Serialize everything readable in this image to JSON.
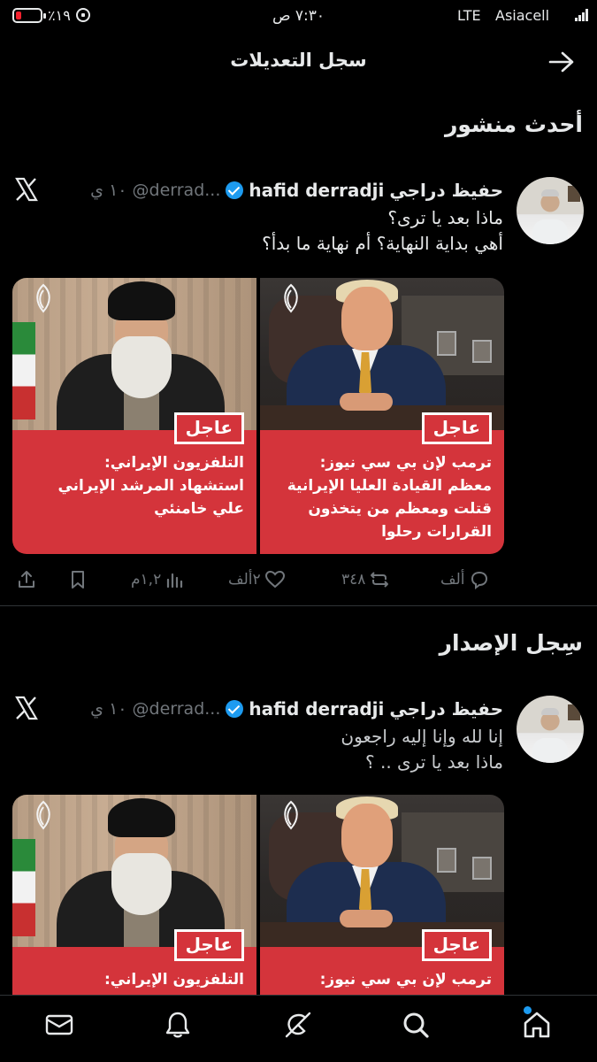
{
  "status_bar": {
    "time": "٧:٣٠ ص",
    "battery": "٪١٩",
    "network": "LTE",
    "carrier": "Asiacell"
  },
  "header": {
    "title": "سجل التعديلات",
    "back_icon": "arrow-right-icon"
  },
  "sections": {
    "latest": "أحدث منشور",
    "history": "سِجل الإصدار"
  },
  "tweets": [
    {
      "name": "حفيظ دراجي",
      "name_latin": "hafid derradji",
      "handle": "@derrad...",
      "time": "١٠ ي",
      "lines": [
        "ماذا بعد يا ترى؟",
        "أهي بداية النهاية؟ أم نهاية ما بدأ؟"
      ],
      "cards": [
        {
          "badge": "عاجل",
          "lines": [
            "ترمب لإن بي سي نيوز:",
            "معظم القيادة العليا الإيرانية",
            "قتلت ومعظم من يتخذون",
            "القرارات رحلوا"
          ]
        },
        {
          "badge": "عاجل",
          "lines": [
            "التلفزيون الإيراني:",
            "استشهاد المرشد الإيراني",
            "علي خامنئي"
          ]
        }
      ],
      "actions": {
        "replies": "ألف",
        "reposts": "٣٤٨",
        "likes": "٢ألف",
        "views": "١,٢م"
      }
    },
    {
      "name": "حفيظ دراجي",
      "name_latin": "hafid derradji",
      "handle": "@derrad...",
      "time": "١٠ ي",
      "lines": [
        "إنا لله وإنا إليه راجعون",
        "ماذا بعد يا ترى .. ؟"
      ],
      "cards": [
        {
          "badge": "عاجل",
          "lines": [
            "ترمب لإن بي سي نيوز:"
          ]
        },
        {
          "badge": "عاجل",
          "lines": [
            "التلفزيون الإيراني:"
          ]
        }
      ]
    }
  ],
  "bottom_nav": [
    "home-icon",
    "search-icon",
    "grok-icon",
    "notifications-icon",
    "messages-icon"
  ],
  "colors": {
    "background": "#000000",
    "accent": "#1d9bf0",
    "muted": "#71767b",
    "breaking_red": "#d4343b"
  }
}
